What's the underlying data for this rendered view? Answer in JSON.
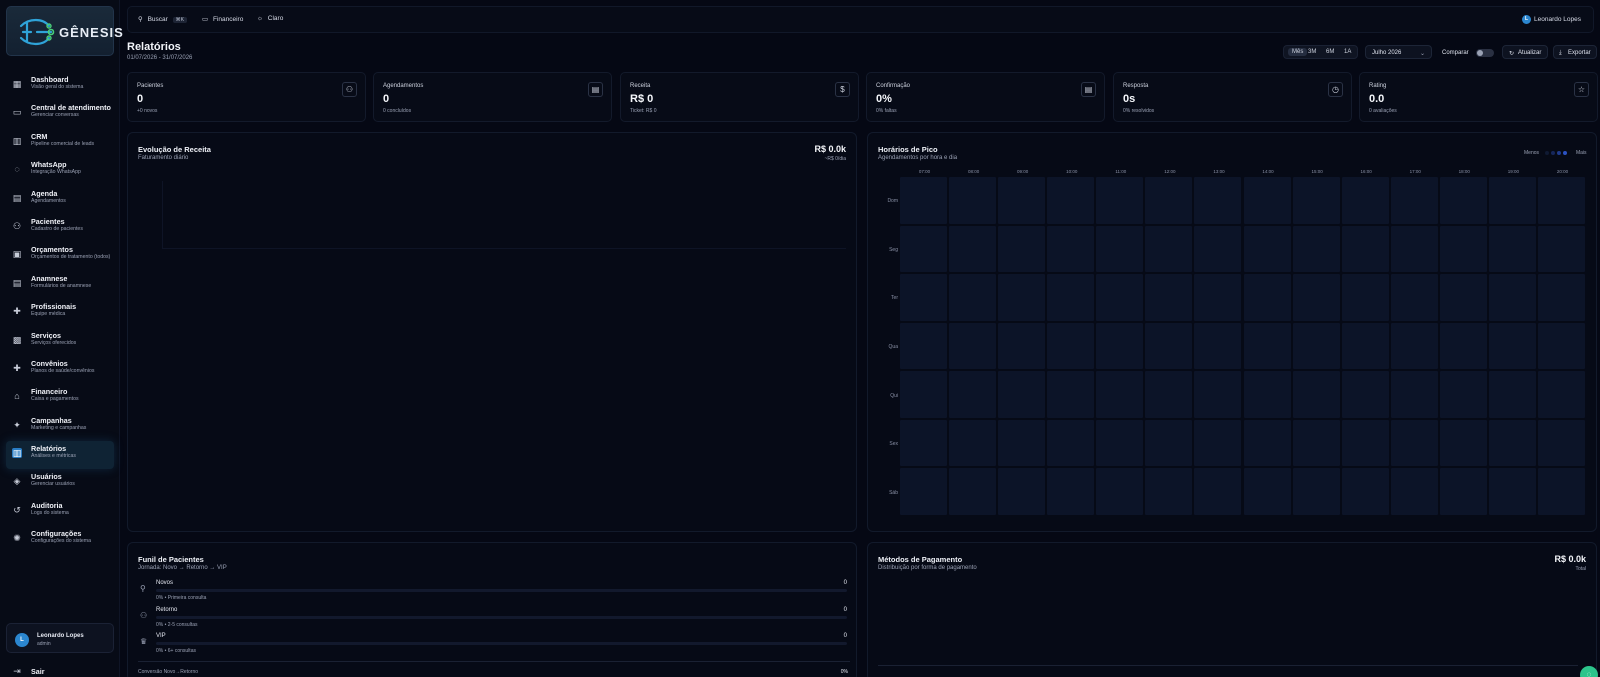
{
  "app": {
    "logo_text": "GÊNESIS"
  },
  "sidebar": {
    "items": [
      {
        "label": "Dashboard",
        "sub": "Visão geral do sistema",
        "icon": "dashboard-icon",
        "glyph": "▦"
      },
      {
        "label": "Central de atendimento",
        "sub": "Gerenciar conversas",
        "icon": "chat-icon",
        "glyph": "▭"
      },
      {
        "label": "CRM",
        "sub": "Pipeline comercial de leads",
        "icon": "kanban-icon",
        "glyph": "▥"
      },
      {
        "label": "WhatsApp",
        "sub": "Integração WhatsApp",
        "icon": "whatsapp-icon",
        "glyph": "◌"
      },
      {
        "label": "Agenda",
        "sub": "Agendamentos",
        "icon": "calendar-icon",
        "glyph": "▤"
      },
      {
        "label": "Pacientes",
        "sub": "Cadastro de pacientes",
        "icon": "users-icon",
        "glyph": "⚇"
      },
      {
        "label": "Orçamentos",
        "sub": "Orçamentos de tratamento (todos)",
        "icon": "receipt-icon",
        "glyph": "▣"
      },
      {
        "label": "Anamnese",
        "sub": "Formulários de anamnese",
        "icon": "clipboard-icon",
        "glyph": "▤"
      },
      {
        "label": "Profissionais",
        "sub": "Equipe médica",
        "icon": "medical-cross-icon",
        "glyph": "✚"
      },
      {
        "label": "Serviços",
        "sub": "Serviços oferecidos",
        "icon": "briefcase-medical-icon",
        "glyph": "▩"
      },
      {
        "label": "Convênios",
        "sub": "Planos de saúde/convênios",
        "icon": "health-plan-icon",
        "glyph": "✚"
      },
      {
        "label": "Financeiro",
        "sub": "Caixa e pagamentos",
        "icon": "bank-icon",
        "glyph": "⌂"
      },
      {
        "label": "Campanhas",
        "sub": "Marketing e campanhas",
        "icon": "sparkles-icon",
        "glyph": "✦"
      },
      {
        "label": "Relatórios",
        "sub": "Análises e métricas",
        "icon": "chart-icon",
        "glyph": "▥"
      },
      {
        "label": "Usuários",
        "sub": "Gerenciar usuários",
        "icon": "shield-user-icon",
        "glyph": "◈"
      },
      {
        "label": "Auditoria",
        "sub": "Logs do sistema",
        "icon": "history-icon",
        "glyph": "↺"
      },
      {
        "label": "Configurações",
        "sub": "Configurações do sistema",
        "icon": "gear-icon",
        "glyph": "✺"
      }
    ],
    "active_index": 13,
    "user": {
      "initial": "L",
      "name": "Leonardo Lopes",
      "role": "admin"
    },
    "logout_label": "Sair"
  },
  "topbar": {
    "search_label": "Buscar",
    "search_kbd": "⌘K",
    "finance_label": "Financeiro",
    "theme_label": "Claro",
    "user_initial": "L",
    "user_name": "Leonardo Lopes"
  },
  "header": {
    "title": "Relatórios",
    "range": "01/07/2026 - 31/07/2026",
    "periods": [
      "Mês",
      "3M",
      "6M",
      "1A"
    ],
    "active_period": "Mês",
    "month_select": "Julho 2026",
    "compare_label": "Comparar",
    "refresh_label": "Atualizar",
    "export_label": "Exportar"
  },
  "kpis": [
    {
      "label": "Pacientes",
      "value": "0",
      "sub": "+0 novos",
      "icon": "users-icon",
      "glyph": "⚇"
    },
    {
      "label": "Agendamentos",
      "value": "0",
      "sub": "0 concluídos",
      "icon": "calendar-icon",
      "glyph": "▤"
    },
    {
      "label": "Receita",
      "value": "R$ 0",
      "sub": "Ticket: R$ 0",
      "icon": "dollar-icon",
      "glyph": "$"
    },
    {
      "label": "Confirmação",
      "value": "0%",
      "sub": "0% faltas",
      "icon": "calendar-check-icon",
      "glyph": "▤"
    },
    {
      "label": "Resposta",
      "value": "0s",
      "sub": "0% resolvidos",
      "icon": "clock-icon",
      "glyph": "◷"
    },
    {
      "label": "Rating",
      "value": "0.0",
      "sub": "0 avaliações",
      "icon": "star-icon",
      "glyph": "☆"
    }
  ],
  "revenue": {
    "title": "Evolução de Receita",
    "sub": "Faturamento diário",
    "total": "R$ 0.0k",
    "total_sub": "~R$ 0/dia"
  },
  "peak": {
    "title": "Horários de Pico",
    "sub": "Agendamentos por hora e dia",
    "legend_less": "Menos",
    "legend_more": "Mais",
    "hours": [
      "07:00",
      "08:00",
      "09:00",
      "10:00",
      "11:00",
      "12:00",
      "13:00",
      "14:00",
      "15:00",
      "16:00",
      "17:00",
      "18:00",
      "19:00",
      "20:00"
    ],
    "days": [
      "Dom",
      "Seg",
      "Ter",
      "Qua",
      "Qui",
      "Sex",
      "Sáb"
    ],
    "cell_color": "#0c1428"
  },
  "funnel": {
    "title": "Funil de Pacientes",
    "sub": "Jornada: Novo → Retorno → VIP",
    "stages": [
      {
        "name": "Novos",
        "count": "0",
        "note": "0% • Primeira consulta",
        "icon": "user-plus-icon",
        "glyph": "⚲"
      },
      {
        "name": "Retorno",
        "count": "0",
        "note": "0% • 2-5 consultas",
        "icon": "users-icon",
        "glyph": "⚇"
      },
      {
        "name": "VIP",
        "count": "0",
        "note": "0% • 6+ consultas",
        "icon": "crown-icon",
        "glyph": "♛"
      }
    ],
    "conversion_label": "Conversão Novo→Retorno",
    "conversion_value": "0%"
  },
  "payments": {
    "title": "Métodos de Pagamento",
    "sub": "Distribuição por forma de pagamento",
    "total": "R$ 0.0k",
    "total_sub": "Total"
  },
  "colors": {
    "accent": "#2a7dc4",
    "fab": "#2cc48b"
  }
}
